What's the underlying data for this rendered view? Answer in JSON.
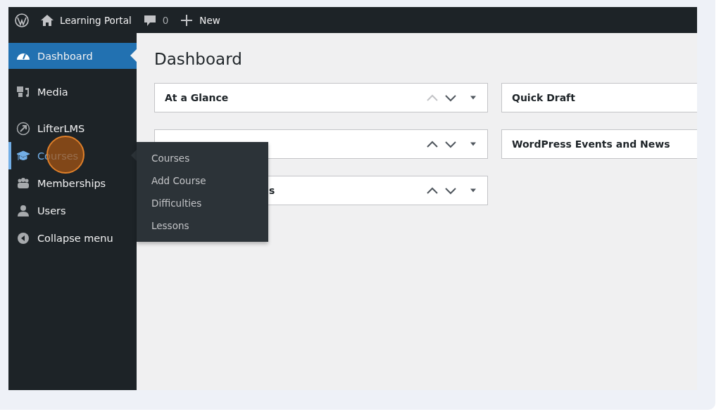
{
  "admin_bar": {
    "site_name": "Learning Portal",
    "comments_count": "0",
    "new_label": "New"
  },
  "sidebar": {
    "items": [
      {
        "label": "Dashboard",
        "selected": true,
        "hover": false,
        "separator_before": false,
        "click_marker": false
      },
      {
        "label": "Media",
        "selected": false,
        "hover": false,
        "separator_before": true,
        "click_marker": false
      },
      {
        "label": "LifterLMS",
        "selected": false,
        "hover": false,
        "separator_before": true,
        "click_marker": false
      },
      {
        "label": "Courses",
        "selected": false,
        "hover": true,
        "separator_before": false,
        "click_marker": true
      },
      {
        "label": "Memberships",
        "selected": false,
        "hover": false,
        "separator_before": false,
        "click_marker": false
      },
      {
        "label": "Users",
        "selected": false,
        "hover": false,
        "separator_before": false,
        "click_marker": false
      },
      {
        "label": "Collapse menu",
        "selected": false,
        "hover": false,
        "separator_before": false,
        "click_marker": false
      }
    ]
  },
  "flyout": {
    "items": [
      "Courses",
      "Add Course",
      "Difficulties",
      "Lessons"
    ]
  },
  "page_title": "Dashboard",
  "left_panels": [
    {
      "title": "At a Glance",
      "covered": false,
      "up_disabled": true
    },
    {
      "up_disabled": false
    },
    {
      "title": "s",
      "covered": true,
      "up_disabled": false
    }
  ],
  "right_panels": [
    {
      "title": "Quick Draft"
    },
    {
      "title": "WordPress Events and News"
    }
  ]
}
